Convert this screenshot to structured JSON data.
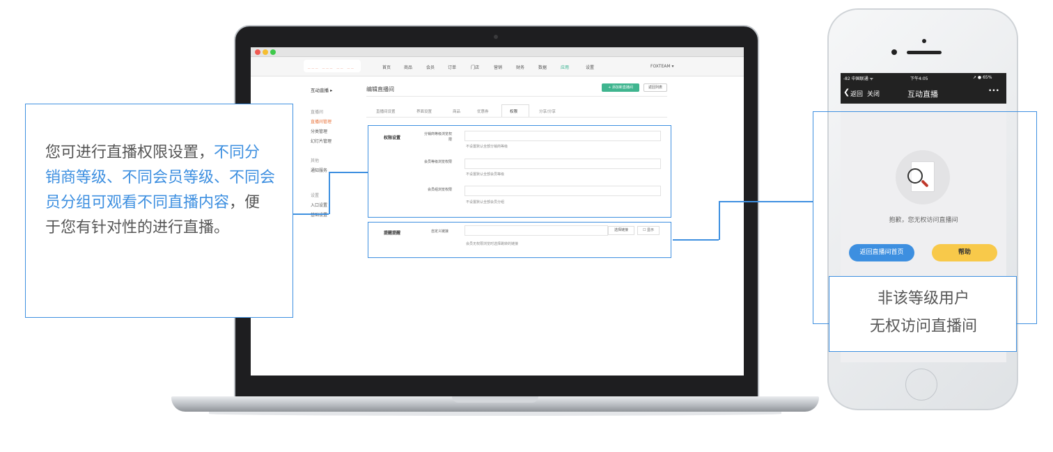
{
  "callout_left": {
    "segments": [
      {
        "text": "您可进行直播权限设置，",
        "highlight": false
      },
      {
        "text": "不同分销商等级、不同会员等级、不同会员分组可观看不同直播内容",
        "highlight": true
      },
      {
        "text": "，便于您有针对性的进行直播。",
        "highlight": false
      }
    ]
  },
  "laptop_screen": {
    "logo_text": "___ ___ __ __",
    "nav": [
      "首页",
      "商品",
      "会员",
      "订单",
      "门店",
      "营销",
      "财务",
      "数据",
      "应用",
      "设置"
    ],
    "nav_active": "应用",
    "account": "FOXTEAM ▾",
    "sidebar": {
      "header": "互动直播 ▸",
      "groups": [
        {
          "title": "直播间",
          "items": [
            "直播间管理",
            "分类管理",
            "幻灯片管理"
          ]
        },
        {
          "title": "其他",
          "items": [
            "通知服务"
          ]
        },
        {
          "title": "设置",
          "items": [
            "入口设置",
            "基础设置"
          ]
        }
      ],
      "highlight_item": "直播间管理"
    },
    "page_title": "编辑直播间",
    "add_button": "+ 添加新直播间",
    "back_button": "返回列表",
    "tabs": [
      "直播间设置",
      "界面设置",
      "商品",
      "优惠券",
      "权限",
      "分享/分享"
    ],
    "active_tab": "权限",
    "permission_section": {
      "label": "权限设置",
      "fields": [
        {
          "label": "分销商等级浏览权限",
          "hint": "不设置默认全部分销商等级"
        },
        {
          "label": "会员等级浏览权限",
          "hint": "不设置默认全部会员等级"
        },
        {
          "label": "会员组浏览权限",
          "hint": "不设置默认全部会员分组"
        }
      ]
    },
    "reminder_section": {
      "label": "提醒提醒",
      "field_label": "自定义链接",
      "select_button": "选择链接",
      "show_checkbox": "显示",
      "hint": "会员无权限浏览时选择跳转的链接"
    }
  },
  "phone": {
    "status_left": "-82 中国联通 ᯤ",
    "status_time": "下午4:05",
    "status_right": "➚ ● 65%",
    "back_label": "返回",
    "close_label": "关闭",
    "title": "互动直播",
    "more": "•••",
    "message": "抱歉，您无权访问直播间",
    "btn_home": "返回直播间首页",
    "btn_help": "帮助"
  },
  "callout_right": {
    "line1": "非该等级用户",
    "line2": "无权访问直播间"
  },
  "colors": {
    "accent_blue": "#3d8fe0",
    "green": "#3fb58f",
    "orange": "#e9753e",
    "yellow": "#f8c94a"
  }
}
